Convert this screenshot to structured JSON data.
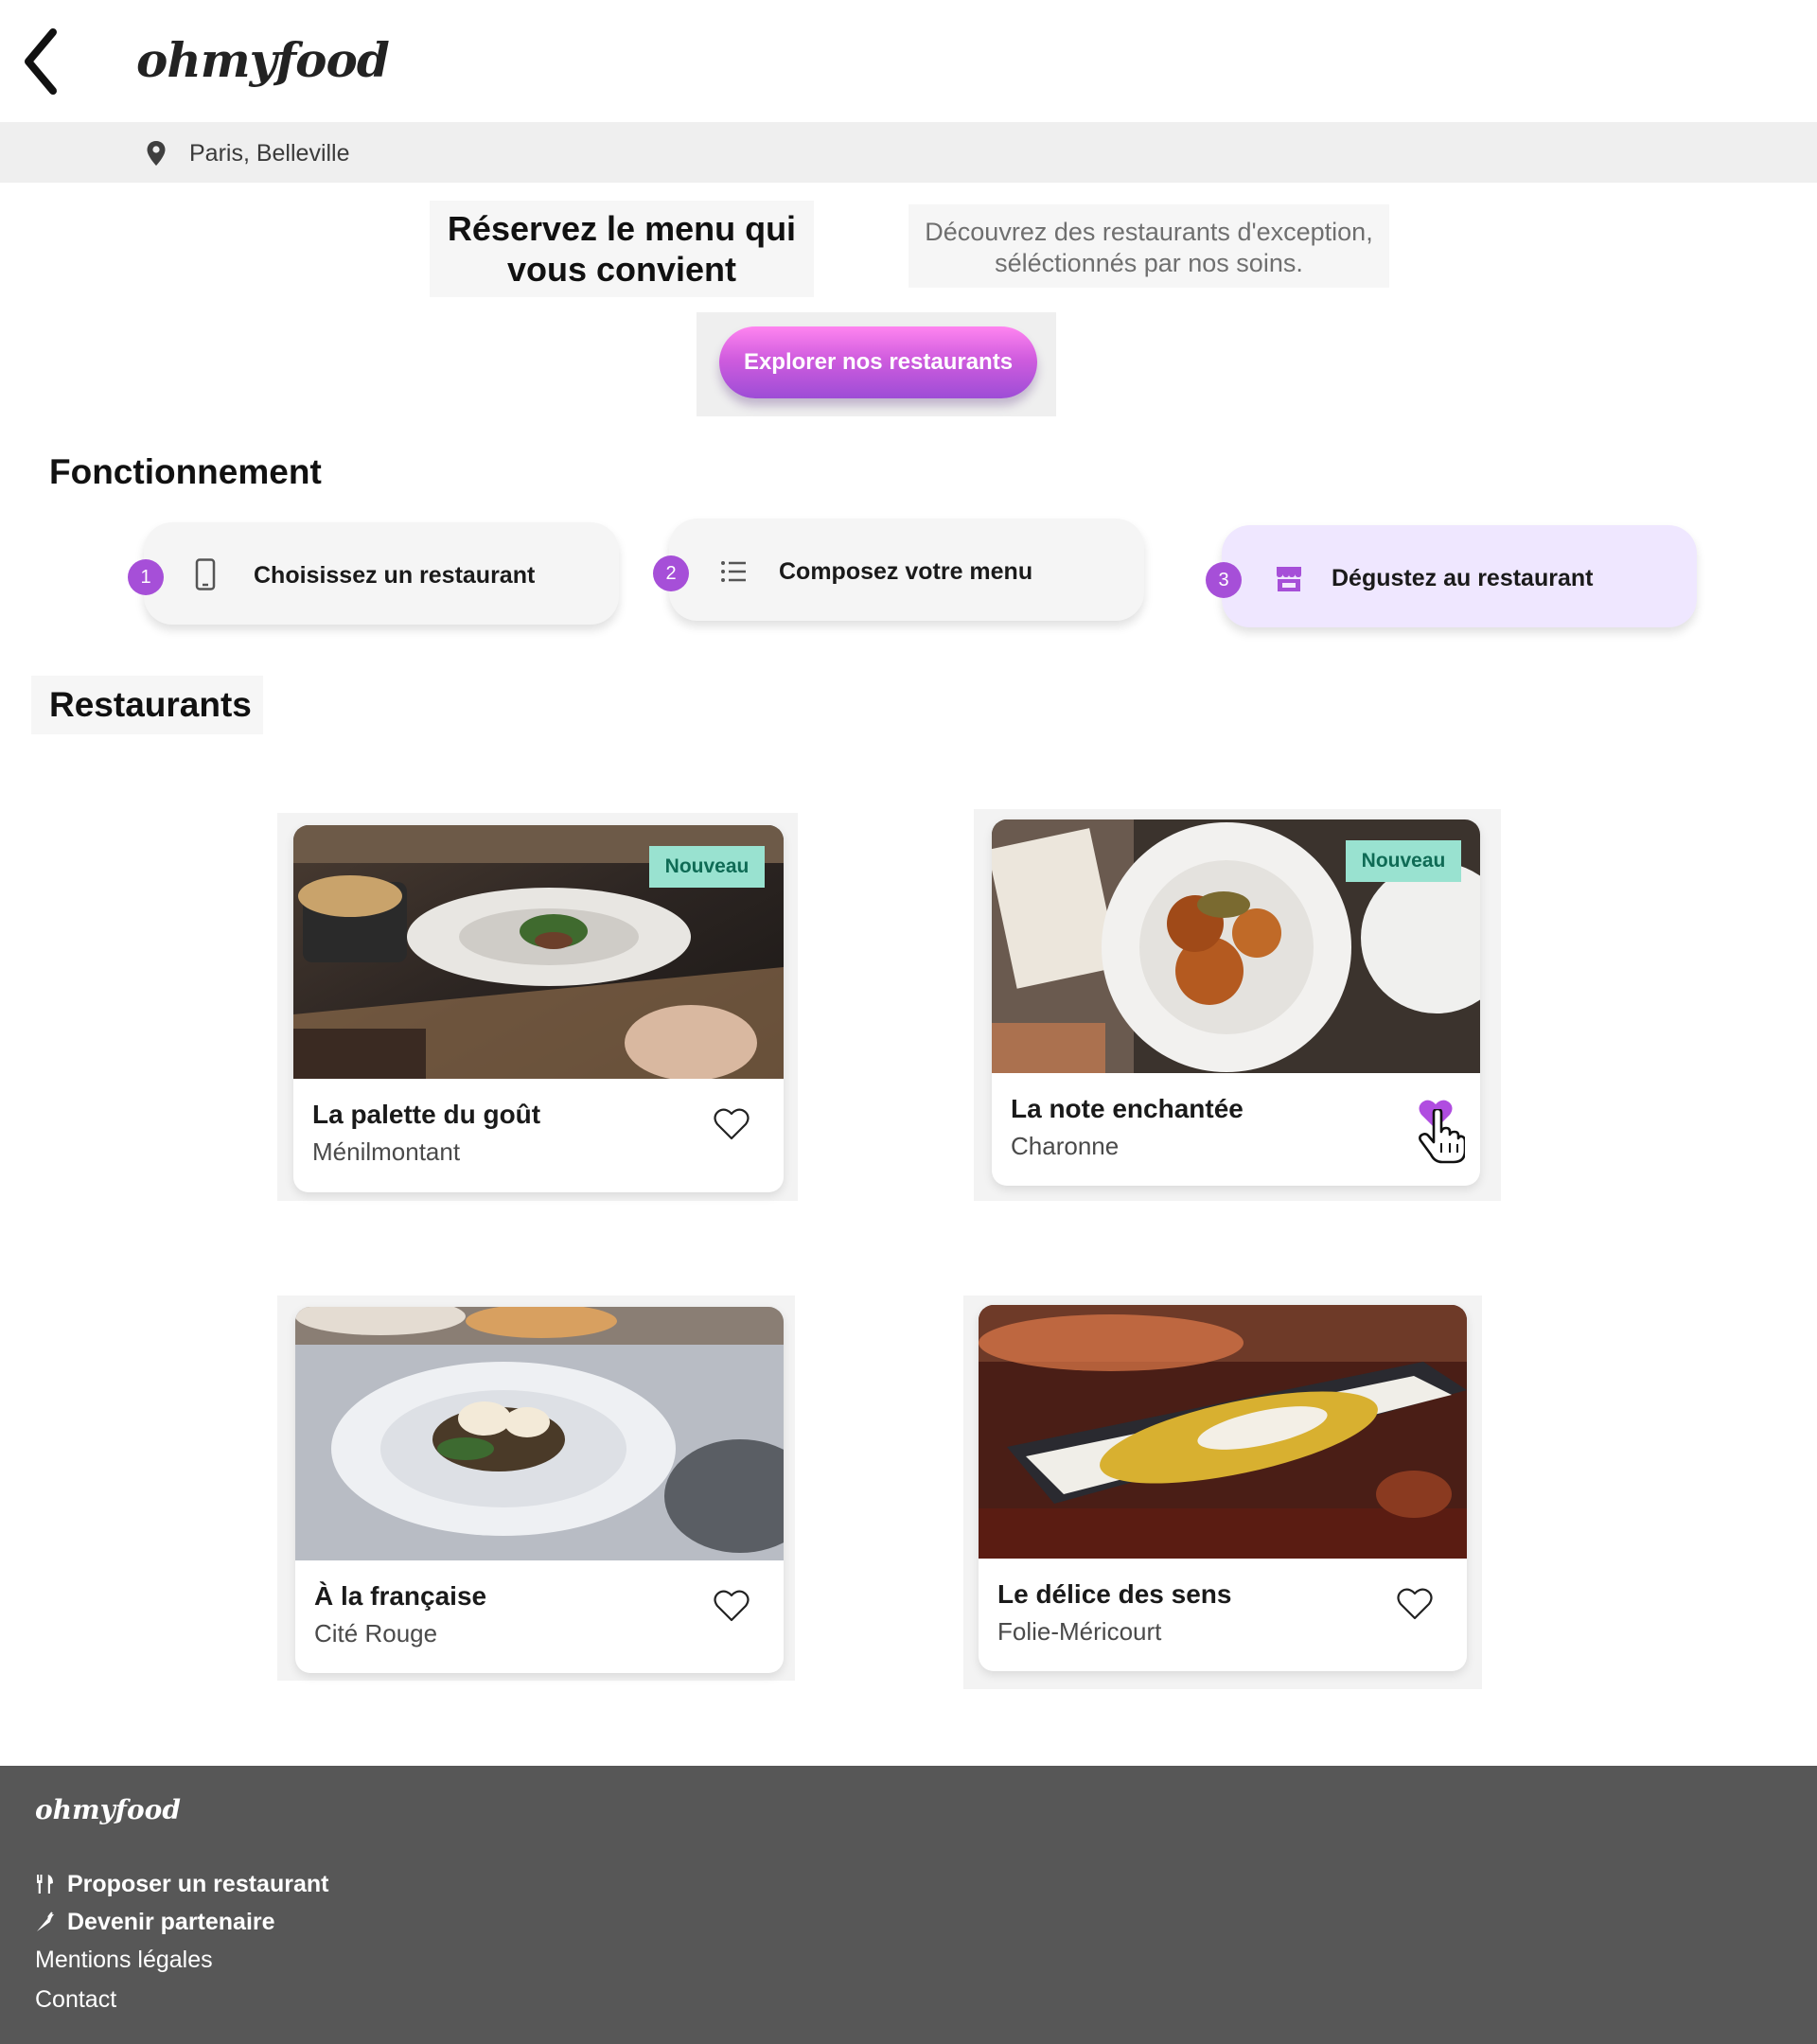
{
  "header": {
    "logo": "ohmyfood",
    "back_icon": "chevron-left-icon"
  },
  "location": {
    "icon": "map-pin-icon",
    "text": "Paris, Belleville"
  },
  "hero": {
    "title_line1": "Réservez le menu qui",
    "title_line2": "vous convient",
    "subtitle_line1": "Découvrez des restaurants d'exception,",
    "subtitle_line2": "séléctionnés par nos soins.",
    "cta_label": "Explorer nos restaurants"
  },
  "how_it_works": {
    "title": "Fonctionnement",
    "steps": [
      {
        "number": "1",
        "icon": "smartphone-icon",
        "label": "Choisissez un restaurant"
      },
      {
        "number": "2",
        "icon": "list-icon",
        "label": "Composez votre menu"
      },
      {
        "number": "3",
        "icon": "store-icon",
        "label": "Dégustez au restaurant"
      }
    ]
  },
  "restaurants": {
    "title": "Restaurants",
    "items": [
      {
        "name": "La palette du goût",
        "area": "Ménilmontant",
        "badge": "Nouveau",
        "liked": false
      },
      {
        "name": "La note enchantée",
        "area": "Charonne",
        "badge": "Nouveau",
        "liked": true
      },
      {
        "name": "À la française",
        "area": "Cité Rouge",
        "badge": "",
        "liked": false
      },
      {
        "name": "Le délice des sens",
        "area": "Folie-Méricourt",
        "badge": "",
        "liked": false
      }
    ]
  },
  "footer": {
    "logo": "ohmyfood",
    "links": [
      {
        "label": "Proposer un restaurant",
        "icon": "utensils-icon"
      },
      {
        "label": "Devenir partenaire",
        "icon": "carrot-icon"
      },
      {
        "label": "Mentions légales",
        "icon": ""
      },
      {
        "label": "Contact",
        "icon": ""
      }
    ]
  },
  "colors": {
    "accent_purple": "#a64fd8",
    "cta_gradient_top": "#ff85f0",
    "cta_gradient_bottom": "#9d4dd6",
    "badge_bg": "#99e2d0",
    "badge_text": "#0f6b55",
    "footer_bg": "#575757",
    "location_bar_bg": "#efefef"
  }
}
